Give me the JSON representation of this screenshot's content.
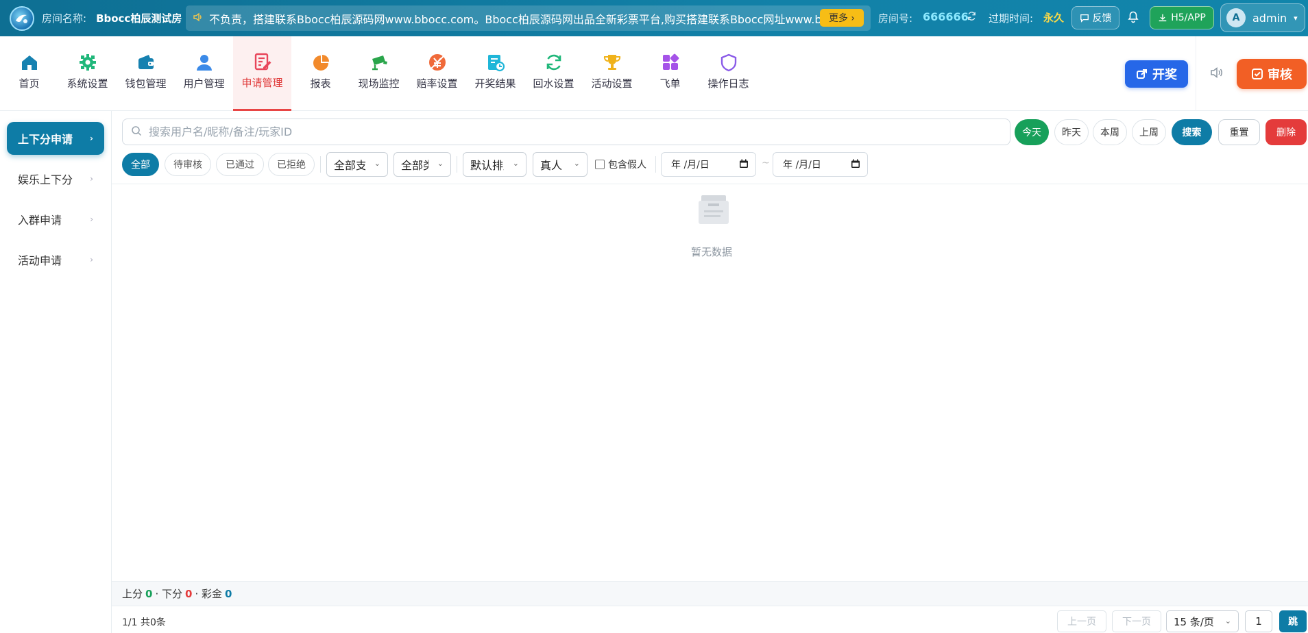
{
  "header": {
    "room_label": "房间名称:",
    "room_name": "Bbocc柏辰测试房",
    "notice": "不负责，搭建联系Bbocc柏辰源码网www.bbocc.com。Bbocc柏辰源码网出品全新彩票平台,购买搭建联系Bbocc网址www.bbocc.com",
    "more_label": "更多 ›",
    "room_no_label": "房间号:",
    "room_no": "666666",
    "expire_label": "过期时间:",
    "expire_value": "永久",
    "feedback_label": "反馈",
    "app_label": "H5/APP",
    "avatar_letter": "A",
    "username": "admin"
  },
  "nav": {
    "items": [
      {
        "label": "首页",
        "icon": "home-icon",
        "color": "#1681b0"
      },
      {
        "label": "系统设置",
        "icon": "gear-icon",
        "color": "#20b77a"
      },
      {
        "label": "钱包管理",
        "icon": "wallet-icon",
        "color": "#1681b0"
      },
      {
        "label": "用户管理",
        "icon": "user-icon",
        "color": "#3b8ae8"
      },
      {
        "label": "申请管理",
        "icon": "edit-doc-icon",
        "color": "#e8455a"
      },
      {
        "label": "报表",
        "icon": "pie-chart-icon",
        "color": "#f28a2c"
      },
      {
        "label": "现场监控",
        "icon": "camera-icon",
        "color": "#2aa54b"
      },
      {
        "label": "赔率设置",
        "icon": "odds-icon",
        "color": "#f06a3a"
      },
      {
        "label": "开奖结果",
        "icon": "result-icon",
        "color": "#1fb6d8"
      },
      {
        "label": "回水设置",
        "icon": "refresh-icon",
        "color": "#20b77a"
      },
      {
        "label": "活动设置",
        "icon": "trophy-icon",
        "color": "#f0b21a"
      },
      {
        "label": "飞单",
        "icon": "grid-icon",
        "color": "#a553e8"
      },
      {
        "label": "操作日志",
        "icon": "shield-icon",
        "color": "#8a5be8"
      }
    ],
    "active_index": 4,
    "draw_label": "开奖",
    "audit_label": "审核"
  },
  "sidebar": {
    "items": [
      {
        "label": "上下分申请"
      },
      {
        "label": "娱乐上下分"
      },
      {
        "label": "入群申请"
      },
      {
        "label": "活动申请"
      }
    ]
  },
  "filters": {
    "search_placeholder": "搜索用户名/昵称/备注/玩家ID",
    "today": "今天",
    "yesterday": "昨天",
    "this_week": "本周",
    "last_week": "上周",
    "search": "搜索",
    "reset": "重置",
    "delete": "删除",
    "status_all": "全部",
    "status_pending": "待审核",
    "status_passed": "已通过",
    "status_rejected": "已拒绝",
    "payment_select": "全部支付",
    "type_select": "全部类",
    "sort_select": "默认排序",
    "player_select": "真人",
    "include_fake": "包含假人",
    "date_from": "年 /月/日",
    "date_to": "年 /月/日",
    "date_sep": "~"
  },
  "empty": {
    "text": "暂无数据"
  },
  "summary": {
    "up_label": "上分",
    "up_value": "0",
    "down_label": "· 下分",
    "down_value": "0",
    "bonus_label": "· 彩金",
    "bonus_value": "0"
  },
  "pagination": {
    "info": "1/1 共0条",
    "prev": "上一页",
    "next": "下一页",
    "page_size": "15 条/页",
    "page_input": "1",
    "go": "跳"
  }
}
